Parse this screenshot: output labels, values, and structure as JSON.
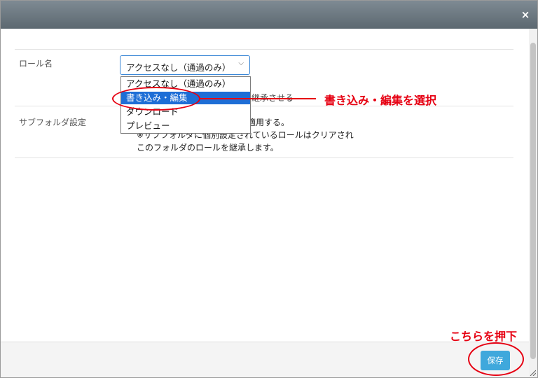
{
  "dialog": {
    "close_label": "×",
    "footer": {
      "save_label": "保存"
    }
  },
  "form": {
    "role_row": {
      "label": "ロール名",
      "select": {
        "value": "アクセスなし（通過のみ）",
        "chevron": "⌵"
      },
      "dropdown_options": [
        "アクセスなし（通過のみ）",
        "書き込み・編集",
        "ダウンロード",
        "プレビュー"
      ],
      "selected_option_index": 1,
      "partially_hidden_text": "継承させる"
    },
    "subfolder_row": {
      "label": "サブフォルダ設定",
      "text_line1": "適用する。",
      "text_line2": "※サブフォルダに個別設定されているロールはクリアされ",
      "text_line3": "このフォルダのロールを継承します。"
    }
  },
  "annotations": {
    "select_note": "書き込み・編集を選択",
    "save_note": "こちらを押下",
    "color": "#e60012"
  },
  "colors": {
    "titlebar": "#66727a",
    "save_button": "#3fa8dc",
    "selected_option": "#1e6ed6"
  }
}
